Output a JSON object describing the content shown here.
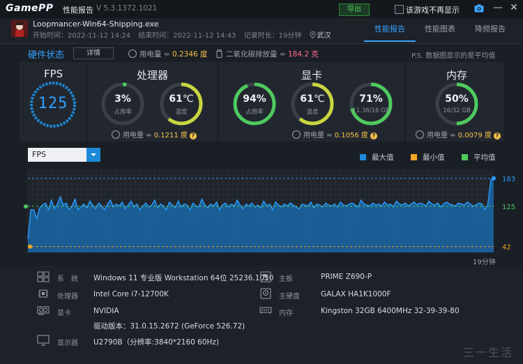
{
  "titlebar": {
    "logo_game": "Game",
    "logo_pp": "PP",
    "title": "性能报告",
    "version": "V 5.3.1372.1021",
    "export_label": "导出",
    "dont_show_label": "该游戏不再显示",
    "icons": [
      "camera-icon",
      "minimize-icon",
      "close-icon"
    ]
  },
  "header": {
    "game_name": "Loopmancer-Win64-Shipping.exe",
    "start_time": "开始时间：2022-11-12 14:24",
    "end_time": "结束时间：2022-11-12 14:43",
    "duration": "记录时长：19分钟",
    "location": "武汉",
    "tabs": [
      {
        "label": "性能报告",
        "active": true
      },
      {
        "label": "性能图表",
        "active": false
      },
      {
        "label": "降频报告",
        "active": false
      }
    ]
  },
  "hardware": {
    "title": "硬件状态",
    "detail_label": "详情",
    "power_label": "用电量 ≈ ",
    "power_value": "0.2346 度",
    "co2_label": "二氧化碳排放量 ≈ ",
    "co2_value": "184.2 克",
    "note": "P.S. 数据图显示的是平均值",
    "accent_color": "#3aa3ff"
  },
  "fps": {
    "title": "FPS",
    "value": "125"
  },
  "cpu": {
    "title": "处理器",
    "usage_value": "3%",
    "usage_label": "占用率",
    "usage_fraction": 0.03,
    "temp_value": "61",
    "temp_unit": "℃",
    "temp_label": "温度",
    "temp_fraction": 0.61,
    "power_label": "用电量 ≈ ",
    "power_value": "0.1211 度"
  },
  "gpu": {
    "title": "显卡",
    "usage_value": "94%",
    "usage_label": "占用率",
    "usage_fraction": 0.94,
    "temp_value": "61",
    "temp_unit": "℃",
    "temp_label": "温度",
    "temp_fraction": 0.61,
    "vram_value": "71%",
    "vram_label": "11.36/16 GB",
    "vram_fraction": 0.71,
    "power_label": "用电量 ≈ ",
    "power_value": "0.1056 度"
  },
  "memory": {
    "title": "内存",
    "usage_value": "50%",
    "usage_label": "16/32 GB",
    "usage_fraction": 0.5,
    "power_label": "用电量 ≈ ",
    "power_value": "0.0079 度"
  },
  "chart": {
    "select_value": "FPS",
    "legend": [
      {
        "label": "最大值",
        "color": "#1c8ad8"
      },
      {
        "label": "最小值",
        "color": "#f5a623"
      },
      {
        "label": "平均值",
        "color": "#4fca5e"
      }
    ],
    "duration_label": "19分钟"
  },
  "chart_data": {
    "type": "area",
    "series": [
      {
        "values": [
          58,
          118,
          118,
          100,
          122,
          128,
          132,
          118,
          138,
          120,
          130,
          145,
          128,
          132,
          118,
          126,
          140,
          118,
          124,
          130,
          122,
          136,
          128,
          120,
          132,
          126,
          118,
          130,
          138,
          124,
          130,
          126,
          134,
          120,
          128,
          136,
          124,
          130,
          118,
          126,
          132,
          124,
          128,
          138,
          122,
          130,
          126,
          118,
          134,
          128,
          122,
          136,
          124,
          130,
          128,
          118,
          132,
          126,
          124,
          140,
          128,
          122,
          130,
          126,
          134,
          118,
          128,
          132,
          124,
          130,
          126,
          138,
          128,
          120,
          130,
          126,
          132,
          124,
          128,
          122,
          136,
          126,
          130,
          118,
          134,
          128,
          124,
          130,
          126,
          132,
          128,
          124,
          120,
          130,
          128,
          126,
          134,
          122,
          130,
          128,
          124,
          132,
          128,
          126,
          130,
          124,
          134,
          128,
          126,
          130,
          132,
          128,
          124,
          138,
          130,
          128,
          126,
          132,
          128,
          130,
          126,
          134,
          128,
          130,
          124,
          136,
          130,
          128,
          132,
          126,
          130,
          134,
          128,
          132,
          130,
          126,
          136,
          130,
          128,
          132,
          124,
          130,
          134,
          130,
          128,
          126,
          132,
          130,
          128,
          134,
          130,
          126,
          128,
          132,
          130,
          118,
          128,
          180,
          183
        ]
      }
    ],
    "max": 183,
    "min": 42,
    "avg": 125,
    "ylim": [
      30,
      200
    ],
    "grid": true
  },
  "system": {
    "os_label": "系　统",
    "os_value": "Windows 11 专业版 Workstation 64位 25236.1010",
    "cpu_label": "处理器",
    "cpu_value": "Intel Core i7-12700K",
    "gpu_label": "显卡",
    "gpu_value": "NVIDIA",
    "driver_value": "驱动版本：31.0.15.2672 (GeForce 526.72)",
    "monitor_label": "显示器",
    "monitor_value": "U2790B（分辨率:3840*2160 60Hz)",
    "board_label": "主板",
    "board_value": "PRIME Z690-P",
    "disk_label": "主硬盘",
    "disk_value": "GALAX HA1K1000F",
    "ram_label": "内存",
    "ram_value": "Kingston 32GB 6400MHz 32-39-39-80"
  },
  "watermark": "三一生活"
}
